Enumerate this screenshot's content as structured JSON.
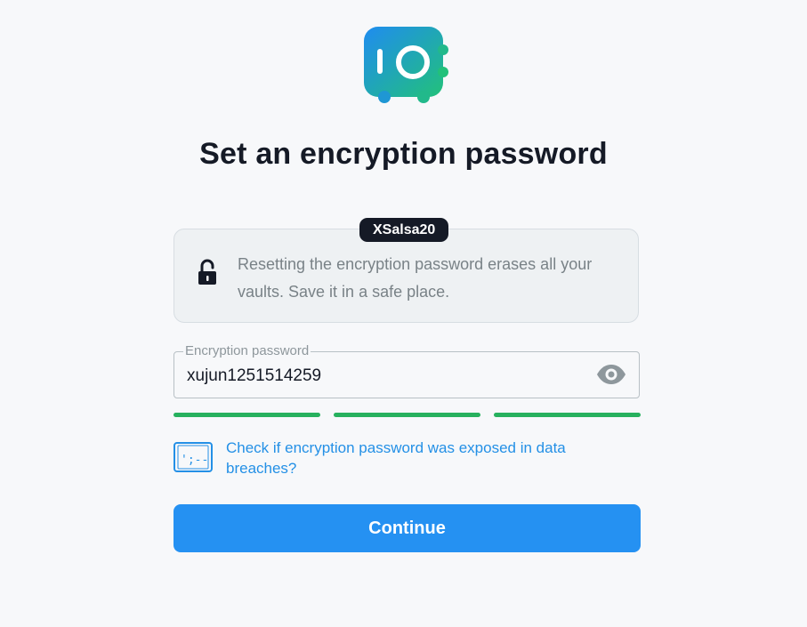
{
  "logo": {
    "icon": "vault-icon",
    "gradient": [
      "#1f8cf0",
      "#22c17a"
    ]
  },
  "heading": "Set an encryption password",
  "info": {
    "badge": "XSalsa20",
    "icon": "unlock-icon",
    "text": "Resetting the encryption password erases all your vaults. Save it in a safe place."
  },
  "password_field": {
    "label": "Encryption password",
    "value": "xujun1251514259",
    "toggle_icon": "eye-icon"
  },
  "strength": {
    "segments_filled": 3,
    "segments_total": 3,
    "color": "#27b15e"
  },
  "breach_check": {
    "icon": "terminal-icon",
    "text": "Check if encryption password was exposed in data breaches?"
  },
  "continue_label": "Continue",
  "colors": {
    "accent": "#2591f2",
    "link": "#2490e6",
    "dark": "#151a26"
  }
}
